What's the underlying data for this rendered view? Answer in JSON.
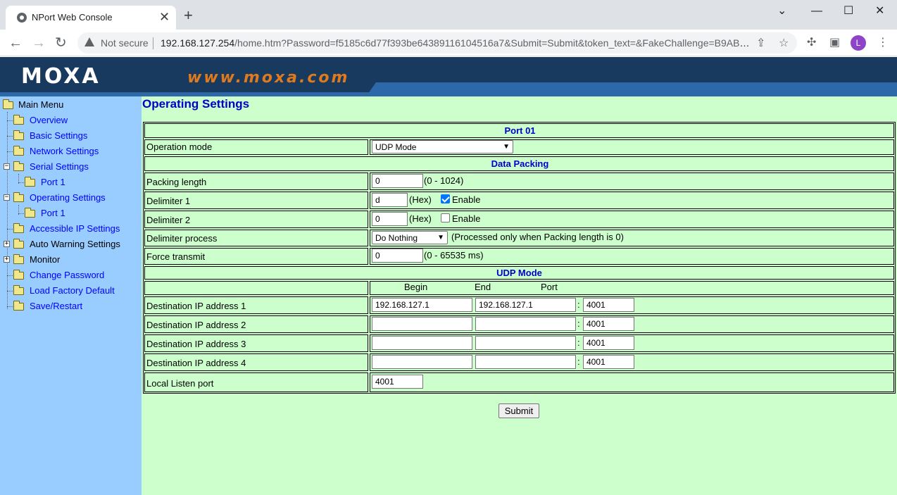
{
  "browser": {
    "tab_title": "NPort Web Console",
    "not_secure": "Not secure",
    "url_host": "192.168.127.254",
    "url_rest": "/home.htm?Password=f5185c6d77f393be64389116104516a7&Submit=Submit&token_text=&FakeChallenge=B9AB6...",
    "avatar_letter": "L"
  },
  "banner": {
    "logo": "MOXA",
    "slogan": "www.moxa.com"
  },
  "menu": {
    "root": "Main Menu",
    "overview": "Overview",
    "basic": "Basic Settings",
    "network": "Network Settings",
    "serial": "Serial Settings",
    "serial_port": "Port 1",
    "operating": "Operating Settings",
    "operating_port": "Port 1",
    "accessible": "Accessible IP Settings",
    "auto_warning": "Auto Warning Settings",
    "monitor": "Monitor",
    "change_password": "Change Password",
    "load_factory": "Load Factory Default",
    "save_restart": "Save/Restart"
  },
  "page": {
    "title": "Operating Settings",
    "port_header": "Port 01",
    "operation_mode_label": "Operation mode",
    "operation_mode_value": "UDP Mode",
    "data_packing_header": "Data Packing",
    "packing_length_label": "Packing length",
    "packing_length_value": "0",
    "packing_length_range": "(0 - 1024)",
    "delimiter1_label": "Delimiter 1",
    "delimiter1_value": "d",
    "delimiter2_label": "Delimiter 2",
    "delimiter2_value": "0",
    "hex_label": "(Hex)",
    "enable_label": "Enable",
    "delimiter_process_label": "Delimiter process",
    "delimiter_process_value": "Do Nothing",
    "delimiter_process_note": "(Processed only when Packing length is 0)",
    "force_transmit_label": "Force transmit",
    "force_transmit_value": "0",
    "force_transmit_range": "(0 - 65535 ms)",
    "udp_header": "UDP Mode",
    "col_begin": "Begin",
    "col_end": "End",
    "col_port": "Port",
    "dest1_label": "Destination IP address 1",
    "dest1_begin": "192.168.127.1",
    "dest1_end": "192.168.127.1",
    "dest1_port": "4001",
    "dest2_label": "Destination IP address 2",
    "dest2_begin": "",
    "dest2_end": "",
    "dest2_port": "4001",
    "dest3_label": "Destination IP address 3",
    "dest3_begin": "",
    "dest3_end": "",
    "dest3_port": "4001",
    "dest4_label": "Destination IP address 4",
    "dest4_begin": "",
    "dest4_end": "",
    "dest4_port": "4001",
    "colon": ":",
    "local_listen_label": "Local Listen port",
    "local_listen_value": "4001",
    "submit_label": "Submit"
  },
  "colors": {
    "sidebar_bg": "#99ccff",
    "content_bg": "#ccffcc",
    "link_blue": "#0000ff",
    "header_blue": "#0000cc",
    "banner_dark": "#173a5e",
    "slogan_orange": "#e07a1c"
  }
}
